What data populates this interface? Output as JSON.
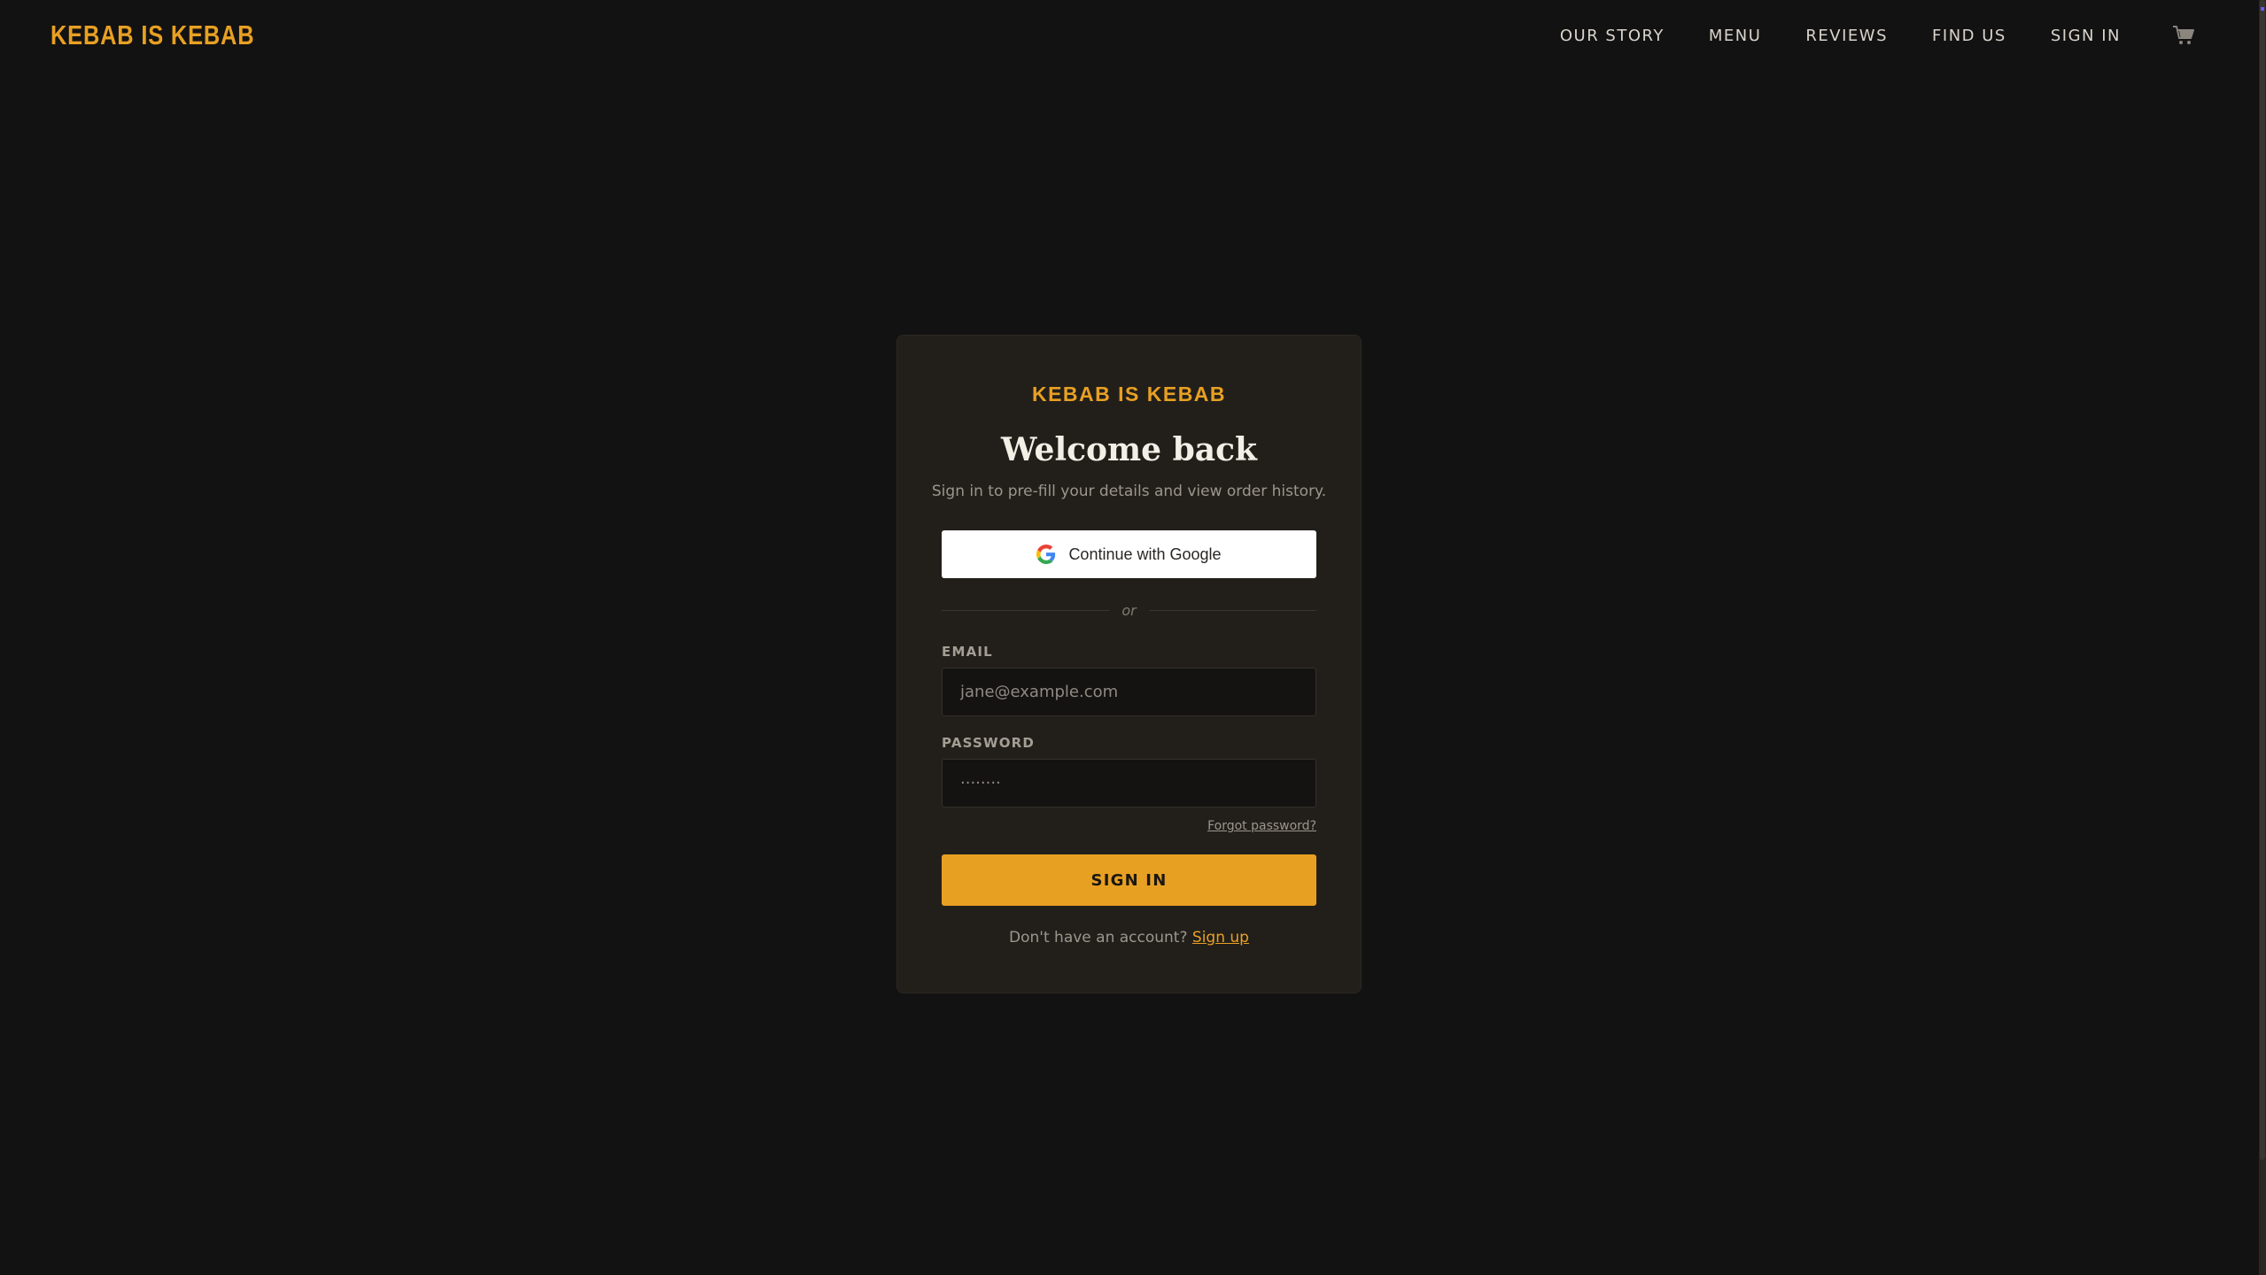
{
  "header": {
    "brand": "KEBAB IS KEBAB",
    "nav": [
      {
        "label": "OUR STORY"
      },
      {
        "label": "MENU"
      },
      {
        "label": "REVIEWS"
      },
      {
        "label": "FIND US"
      },
      {
        "label": "SIGN IN"
      }
    ],
    "cart_icon": "cart-icon"
  },
  "login": {
    "brand": "KEBAB IS KEBAB",
    "title": "Welcome back",
    "subtitle": "Sign in to pre-fill your details and view order history.",
    "google_label": "Continue with Google",
    "divider_text": "or",
    "email_label": "EMAIL",
    "email_placeholder": "jane@example.com",
    "password_label": "PASSWORD",
    "password_placeholder": "········",
    "forgot_label": "Forgot password?",
    "submit_label": "SIGN IN",
    "signup_prompt": "Don't have an account?",
    "signup_link": "Sign up"
  },
  "colors": {
    "accent": "#e8a023",
    "background": "#131212",
    "card": "#221f1b"
  }
}
